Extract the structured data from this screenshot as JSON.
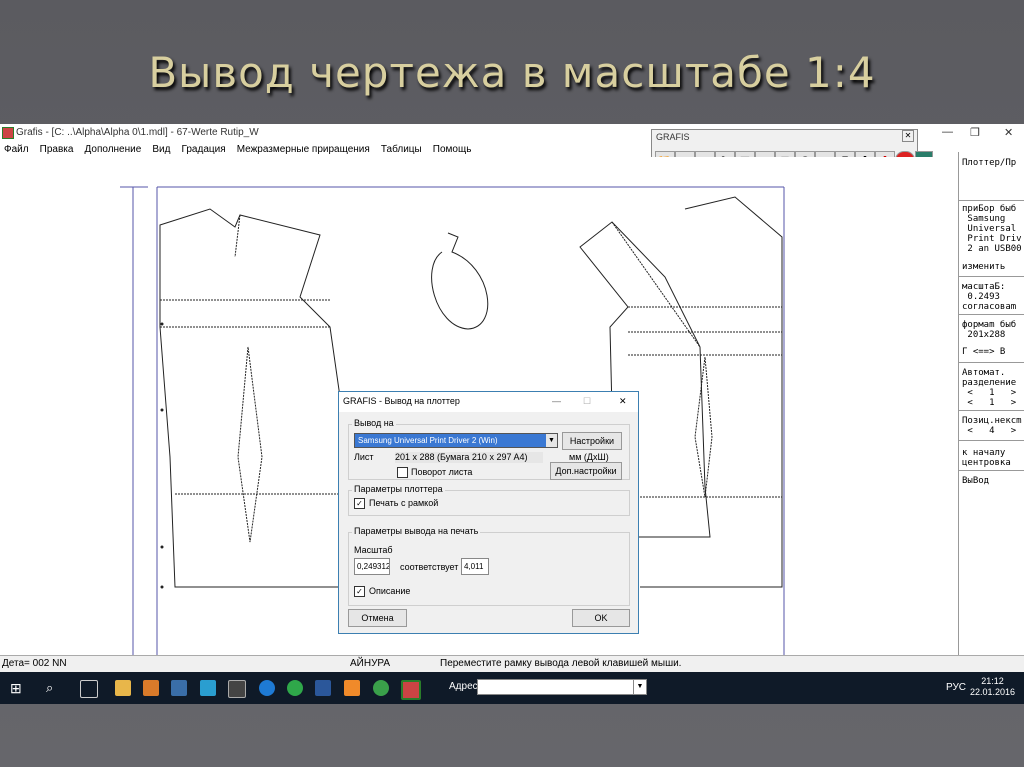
{
  "slide": {
    "title": "Вывод чертежа в масштабе 1:4"
  },
  "window": {
    "title": "Grafis - [C: ..\\Alpha\\Alpha 0\\1.mdl] - 67-Werte Rutip_W",
    "menu": [
      "Файл",
      "Правка",
      "Дополнение",
      "Вид",
      "Градация",
      "Межразмерные приращения",
      "Таблицы",
      "Помощь"
    ]
  },
  "toolbar": {
    "title": "GRAFIS"
  },
  "right_panel": {
    "items": [
      "Плоттер/Пр",
      "приБор быб\n Samsung\n Universal\n Print Driv\n 2 an USB00",
      "изменить",
      "масштаБ:\n 0.2493\nсогласоваm",
      "формаm быб\n 201x288",
      "Г <==> В",
      "Автомат.\nразделение\n <   1   >\n <   1   >",
      "Позиц.нексm\n <   4   >",
      "к началу\nцентровка",
      "ВыВод"
    ]
  },
  "dialog": {
    "title": "GRAFIS - Вывод на плоттер",
    "output_group": "Вывод на",
    "printer": "Samsung Universal Print Driver 2 (Win)",
    "settings_button": "Настройки",
    "sheet_label": "Лист",
    "sheet_value": "201 x 288 (Бумага 210 x 297 A4)",
    "units": "мм (ДxШ)",
    "rotate_label": "Поворот листа",
    "more_settings_button": "Доп.настройки",
    "plotter_group": "Параметры плоттера",
    "frame_label": "Печать с рамкой",
    "print_group": "Параметры вывода на печать",
    "scale_label": "Масштаб",
    "scale_value": "0,249312",
    "corresponds_label": "соответствует",
    "corresponds_value": "4,011",
    "description_label": "Описание",
    "cancel_button": "Отмена",
    "ok_button": "OK"
  },
  "status": {
    "left": "Дета= 002  NN",
    "middle": "АЙНУРА",
    "message": "Переместите рамку вывода левой клавишей мыши."
  },
  "taskbar": {
    "address_label": "Адрес",
    "lang": "РУС",
    "time": "21:12",
    "date": "22.01.2016"
  }
}
